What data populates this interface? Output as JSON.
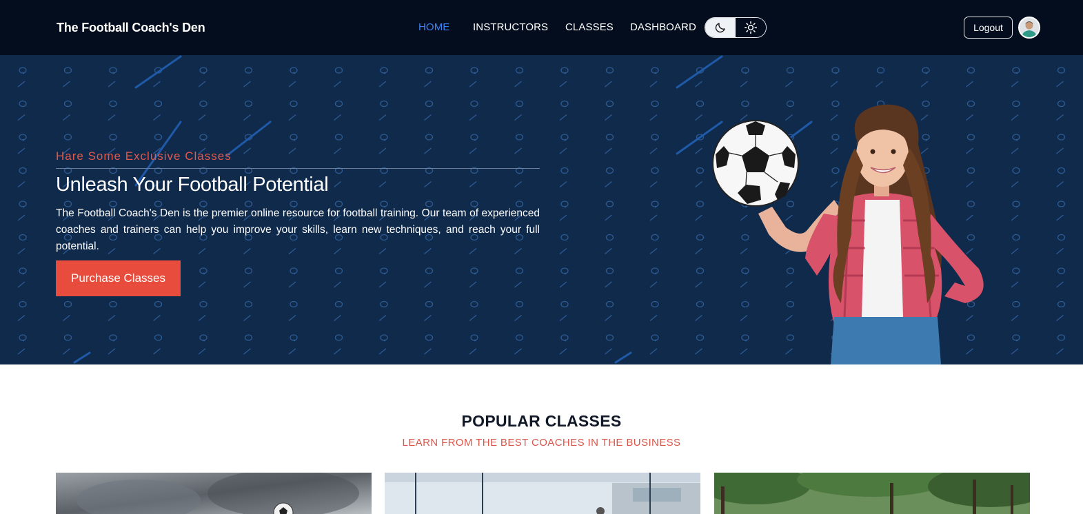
{
  "brand": "The Football Coach's Den",
  "nav": {
    "items": [
      {
        "label": "HOME",
        "active": true
      },
      {
        "label": "INSTRUCTORS",
        "active": false
      },
      {
        "label": "CLASSES",
        "active": false
      },
      {
        "label": "DASHBOARD",
        "active": false
      }
    ],
    "theme_toggle": {
      "dark_icon": "moon-icon",
      "light_icon": "sun-icon"
    },
    "logout_label": "Logout"
  },
  "hero": {
    "kicker": "Hare Some Exclusive Classes",
    "title": "Unleash Your Football Potential",
    "text": "The Football Coach's Den is the premier online resource for football training. Our team of experienced coaches and trainers can help you improve your skills, learn new techniques, and reach your full potential.",
    "cta_label": "Purchase Classes"
  },
  "popular": {
    "title": "POPULAR CLASSES",
    "subtitle": "LEARN FROM THE BEST COACHES IN THE BUSINESS"
  },
  "colors": {
    "nav_bg": "#030d1e",
    "hero_bg": "#102a4c",
    "accent_red": "#e84c3d",
    "active_blue": "#3b82f6"
  }
}
